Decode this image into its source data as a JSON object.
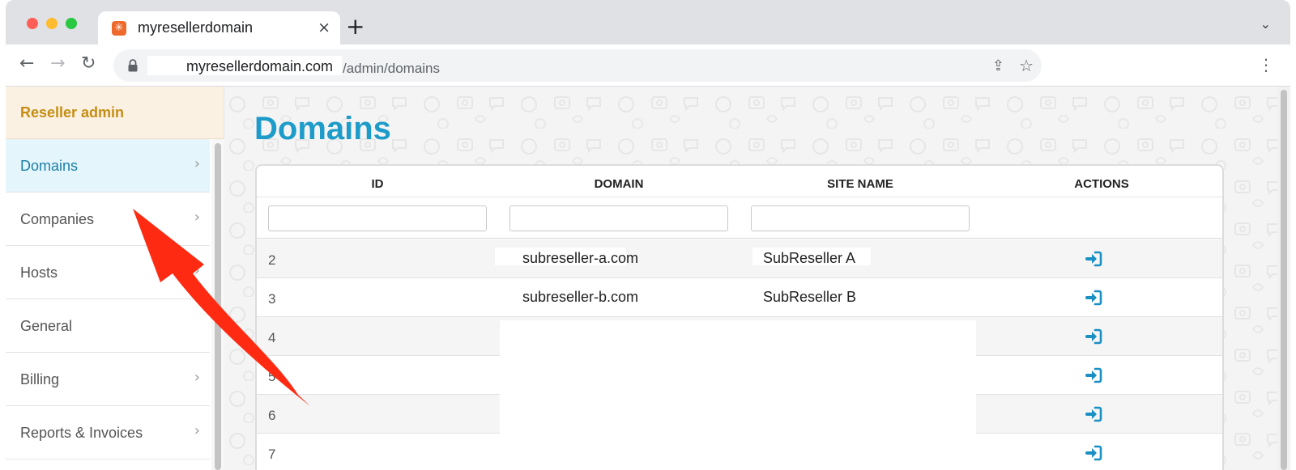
{
  "browser": {
    "tab_title": "myresellerdomain",
    "tab_close": "×",
    "new_tab": "+",
    "url_host": "myresellerdomain.com",
    "url_path": "/admin/domains"
  },
  "sidebar": {
    "title": "Reseller admin",
    "items": [
      {
        "label": "Domains",
        "active": true,
        "chevron": "›"
      },
      {
        "label": "Companies",
        "active": false,
        "chevron": "›"
      },
      {
        "label": "Hosts",
        "active": false,
        "chevron": "›"
      },
      {
        "label": "General",
        "active": false,
        "chevron": ""
      },
      {
        "label": "Billing",
        "active": false,
        "chevron": "›"
      },
      {
        "label": "Reports & Invoices",
        "active": false,
        "chevron": "›"
      }
    ]
  },
  "main": {
    "title": "Domains",
    "table": {
      "columns": [
        "ID",
        "DOMAIN",
        "SITE NAME",
        "ACTIONS"
      ],
      "rows": [
        {
          "id": "2",
          "domain": "subreseller-a.com",
          "site_name": "SubReseller A",
          "action_icon": "login-icon"
        },
        {
          "id": "3",
          "domain": "subreseller-b.com",
          "site_name": "SubReseller B",
          "action_icon": "login-icon"
        },
        {
          "id": "4",
          "domain": "",
          "site_name": "",
          "action_icon": "login-icon"
        },
        {
          "id": "5",
          "domain": "",
          "site_name": "",
          "action_icon": "login-icon"
        },
        {
          "id": "6",
          "domain": "",
          "site_name": "",
          "action_icon": "login-icon"
        },
        {
          "id": "7",
          "domain": "",
          "site_name": "",
          "action_icon": "login-icon"
        }
      ]
    }
  },
  "colors": {
    "accent": "#1e9cc9",
    "sidebar_title": "#c68d12",
    "annotation_arrow": "#ff2a12"
  }
}
